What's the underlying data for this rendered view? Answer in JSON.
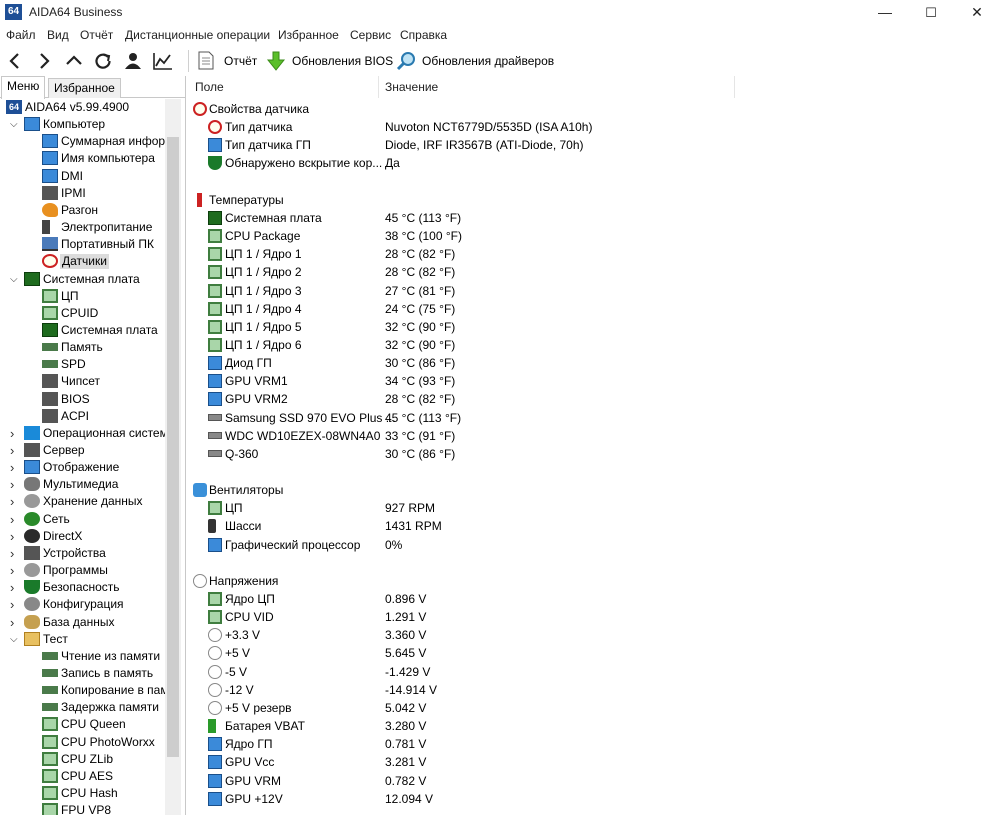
{
  "window": {
    "title": "AIDA64 Business",
    "logo_text": "64",
    "minimize": "—",
    "maximize": "☐",
    "close": "✕"
  },
  "menu": [
    "Файл",
    "Вид",
    "Отчёт",
    "Дистанционные операции",
    "Избранное",
    "Сервис",
    "Справка"
  ],
  "toolbar": {
    "report": "Отчёт",
    "bios_update": "Обновления BIOS",
    "driver_update": "Обновления драйверов"
  },
  "left_tabs": [
    "Меню",
    "Избранное"
  ],
  "tree_root": "AIDA64 v5.99.4900",
  "tree": [
    {
      "label": "Компьютер",
      "level": 0,
      "icon": "monitor-icon",
      "expanded": true
    },
    {
      "label": "Суммарная инфор",
      "level": 1,
      "icon": "monitor-icon"
    },
    {
      "label": "Имя компьютера",
      "level": 1,
      "icon": "monitor-icon"
    },
    {
      "label": "DMI",
      "level": 1,
      "icon": "dmi-icon"
    },
    {
      "label": "IPMI",
      "level": 1,
      "icon": "ipmi-icon"
    },
    {
      "label": "Разгон",
      "level": 1,
      "icon": "fire-icon"
    },
    {
      "label": "Электропитание",
      "level": 1,
      "icon": "plug-icon"
    },
    {
      "label": "Портативный ПК",
      "level": 1,
      "icon": "laptop-icon"
    },
    {
      "label": "Датчики",
      "level": 1,
      "icon": "gauge-icon",
      "selected": true
    },
    {
      "label": "Системная плата",
      "level": 0,
      "icon": "motherboard-icon",
      "expanded": true
    },
    {
      "label": "ЦП",
      "level": 1,
      "icon": "chip-icon"
    },
    {
      "label": "CPUID",
      "level": 1,
      "icon": "chip-icon"
    },
    {
      "label": "Системная плата",
      "level": 1,
      "icon": "motherboard-icon"
    },
    {
      "label": "Память",
      "level": 1,
      "icon": "ram-icon"
    },
    {
      "label": "SPD",
      "level": 1,
      "icon": "ram-icon"
    },
    {
      "label": "Чипсет",
      "level": 1,
      "icon": "chipset-icon"
    },
    {
      "label": "BIOS",
      "level": 1,
      "icon": "bios-icon"
    },
    {
      "label": "ACPI",
      "level": 1,
      "icon": "acpi-icon"
    },
    {
      "label": "Операционная систем",
      "level": 0,
      "icon": "windows-icon",
      "expanded": false
    },
    {
      "label": "Сервер",
      "level": 0,
      "icon": "server-icon",
      "expanded": false
    },
    {
      "label": "Отображение",
      "level": 0,
      "icon": "monitor-icon",
      "expanded": false
    },
    {
      "label": "Мультимедиа",
      "level": 0,
      "icon": "multimedia-icon",
      "expanded": false
    },
    {
      "label": "Хранение данных",
      "level": 0,
      "icon": "storage-icon",
      "expanded": false
    },
    {
      "label": "Сеть",
      "level": 0,
      "icon": "network-icon",
      "expanded": false
    },
    {
      "label": "DirectX",
      "level": 0,
      "icon": "directx-icon",
      "expanded": false
    },
    {
      "label": "Устройства",
      "level": 0,
      "icon": "devices-icon",
      "expanded": false
    },
    {
      "label": "Программы",
      "level": 0,
      "icon": "programs-icon",
      "expanded": false
    },
    {
      "label": "Безопасность",
      "level": 0,
      "icon": "shield-icon",
      "expanded": false
    },
    {
      "label": "Конфигурация",
      "level": 0,
      "icon": "config-icon",
      "expanded": false
    },
    {
      "label": "База данных",
      "level": 0,
      "icon": "database-icon",
      "expanded": false
    },
    {
      "label": "Тест",
      "level": 0,
      "icon": "folder-icon",
      "expanded": true
    },
    {
      "label": "Чтение из памяти",
      "level": 1,
      "icon": "ram-icon"
    },
    {
      "label": "Запись в память",
      "level": 1,
      "icon": "ram-icon"
    },
    {
      "label": "Копирование в пам",
      "level": 1,
      "icon": "ram-icon"
    },
    {
      "label": "Задержка памяти",
      "level": 1,
      "icon": "ram-icon"
    },
    {
      "label": "CPU Queen",
      "level": 1,
      "icon": "chip-icon"
    },
    {
      "label": "CPU PhotoWorxx",
      "level": 1,
      "icon": "chip-icon"
    },
    {
      "label": "CPU ZLib",
      "level": 1,
      "icon": "chip-icon"
    },
    {
      "label": "CPU AES",
      "level": 1,
      "icon": "chip-icon"
    },
    {
      "label": "CPU Hash",
      "level": 1,
      "icon": "chip-icon"
    },
    {
      "label": "FPU VP8",
      "level": 1,
      "icon": "chip-icon"
    }
  ],
  "columns": {
    "field": "Поле",
    "value": "Значение"
  },
  "sections": [
    {
      "title": "Свойства датчика",
      "icon": "gauge-icon",
      "rows": [
        {
          "field": "Тип датчика",
          "value": "Nuvoton NCT6779D/5535D  (ISA A10h)",
          "icon": "gauge-icon"
        },
        {
          "field": "Тип датчика ГП",
          "value": "Diode, IRF IR3567B  (ATI-Diode, 70h)",
          "icon": "gpu-icon"
        },
        {
          "field": "Обнаружено вскрытие кор...",
          "value": "Да",
          "icon": "shield-icon"
        }
      ]
    },
    {
      "title": "Температуры",
      "icon": "thermometer-icon",
      "rows": [
        {
          "field": "Системная плата",
          "value": "45 °C  (113 °F)",
          "icon": "motherboard-icon"
        },
        {
          "field": "CPU Package",
          "value": "38 °C  (100 °F)",
          "icon": "chip-icon"
        },
        {
          "field": "ЦП 1 / Ядро 1",
          "value": "28 °C  (82 °F)",
          "icon": "chip-icon"
        },
        {
          "field": "ЦП 1 / Ядро 2",
          "value": "28 °C  (82 °F)",
          "icon": "chip-icon"
        },
        {
          "field": "ЦП 1 / Ядро 3",
          "value": "27 °C  (81 °F)",
          "icon": "chip-icon"
        },
        {
          "field": "ЦП 1 / Ядро 4",
          "value": "24 °C  (75 °F)",
          "icon": "chip-icon"
        },
        {
          "field": "ЦП 1 / Ядро 5",
          "value": "32 °C  (90 °F)",
          "icon": "chip-icon"
        },
        {
          "field": "ЦП 1 / Ядро 6",
          "value": "32 °C  (90 °F)",
          "icon": "chip-icon"
        },
        {
          "field": "Диод ГП",
          "value": "30 °C  (86 °F)",
          "icon": "gpu-icon"
        },
        {
          "field": "GPU VRM1",
          "value": "34 °C  (93 °F)",
          "icon": "gpu-icon"
        },
        {
          "field": "GPU VRM2",
          "value": "28 °C  (82 °F)",
          "icon": "gpu-icon"
        },
        {
          "field": "Samsung SSD 970 EVO Plus ...",
          "value": "45 °C  (113 °F)",
          "icon": "drive-icon"
        },
        {
          "field": "WDC WD10EZEX-08WN4A0",
          "value": "33 °C  (91 °F)",
          "icon": "drive-icon"
        },
        {
          "field": "Q-360",
          "value": "30 °C  (86 °F)",
          "icon": "drive-icon"
        }
      ]
    },
    {
      "title": "Вентиляторы",
      "icon": "fan-icon",
      "rows": [
        {
          "field": "ЦП",
          "value": "927 RPM",
          "icon": "chip-icon"
        },
        {
          "field": "Шасси",
          "value": "1431 RPM",
          "icon": "chassis-icon"
        },
        {
          "field": "Графический процессор",
          "value": "0%",
          "icon": "gpu-icon"
        }
      ]
    },
    {
      "title": "Напряжения",
      "icon": "voltage-icon",
      "rows": [
        {
          "field": "Ядро ЦП",
          "value": "0.896 V",
          "icon": "chip-icon"
        },
        {
          "field": "CPU VID",
          "value": "1.291 V",
          "icon": "chip-icon"
        },
        {
          "field": "+3.3 V",
          "value": "3.360 V",
          "icon": "voltage-icon"
        },
        {
          "field": "+5 V",
          "value": "5.645 V",
          "icon": "voltage-icon"
        },
        {
          "field": "-5 V",
          "value": "-1.429 V",
          "icon": "voltage-icon"
        },
        {
          "field": "-12 V",
          "value": "-14.914 V",
          "icon": "voltage-icon"
        },
        {
          "field": "+5 V резерв",
          "value": "5.042 V",
          "icon": "voltage-icon"
        },
        {
          "field": "Батарея VBAT",
          "value": "3.280 V",
          "icon": "battery-icon"
        },
        {
          "field": "Ядро ГП",
          "value": "0.781 V",
          "icon": "gpu-icon"
        },
        {
          "field": "GPU Vcc",
          "value": "3.281 V",
          "icon": "gpu-icon"
        },
        {
          "field": "GPU VRM",
          "value": "0.782 V",
          "icon": "gpu-icon"
        },
        {
          "field": "GPU +12V",
          "value": "12.094 V",
          "icon": "gpu-icon"
        }
      ]
    }
  ]
}
